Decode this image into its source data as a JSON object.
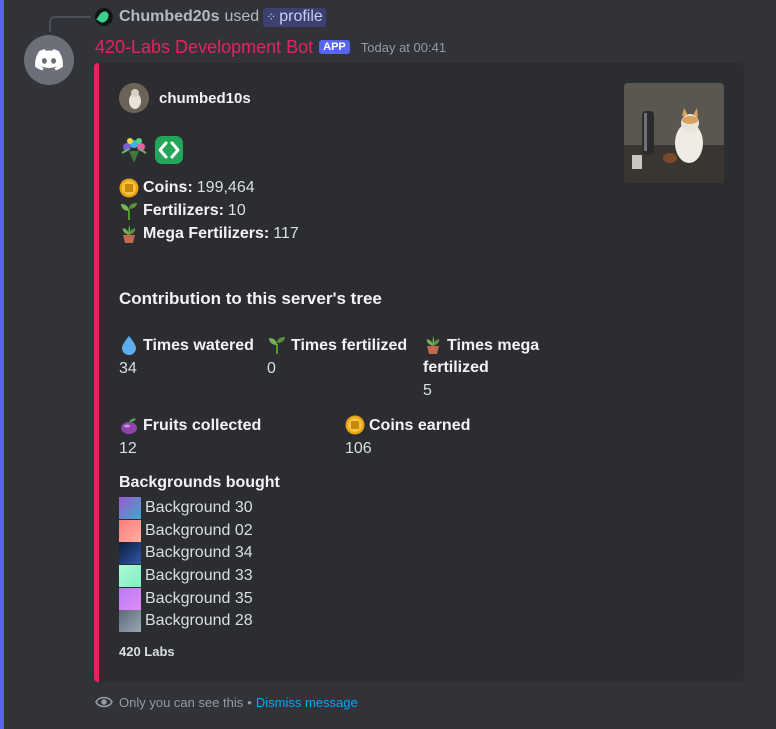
{
  "reply": {
    "user": "Chumbed20s",
    "used_text": "used",
    "command": "profile"
  },
  "message": {
    "bot_name": "420-Labs Development Bot",
    "badge": "APP",
    "timestamp": "Today at 00:41"
  },
  "embed": {
    "accent_color": "#e4245c",
    "author": "chumbed10s",
    "stats": [
      {
        "label": "Coins:",
        "value": "199,464",
        "icon": "coin-icon"
      },
      {
        "label": "Fertilizers:",
        "value": "10",
        "icon": "sprout-icon"
      },
      {
        "label": "Mega Fertilizers:",
        "value": "117",
        "icon": "potted-plant-icon"
      }
    ],
    "section_title": "Contribution to this server's tree",
    "fields": {
      "watered": {
        "label": "Times watered",
        "value": "34",
        "icon": "water-drop-icon"
      },
      "fertilized": {
        "label": "Times fertilized",
        "value": "0",
        "icon": "sprout-icon"
      },
      "mega": {
        "label": "Times mega fertilized",
        "value": "5",
        "icon": "potted-plant-icon"
      },
      "fruits": {
        "label": "Fruits collected",
        "value": "12",
        "icon": "fruit-icon"
      },
      "coins_earned": {
        "label": "Coins earned",
        "value": "106",
        "icon": "coin-icon"
      }
    },
    "backgrounds_title": "Backgrounds bought",
    "backgrounds": [
      {
        "name": "Background 30",
        "colors": [
          "#9b59d0",
          "#3fa9c9"
        ]
      },
      {
        "name": "Background 02",
        "colors": [
          "#ff7b7b",
          "#ffb0a0"
        ]
      },
      {
        "name": "Background 34",
        "colors": [
          "#0c1b3a",
          "#2e5aa8"
        ]
      },
      {
        "name": "Background 33",
        "colors": [
          "#aef8d8",
          "#7ef0c0"
        ]
      },
      {
        "name": "Background 35",
        "colors": [
          "#b57cf0",
          "#e08cf8"
        ]
      },
      {
        "name": "Background 28",
        "colors": [
          "#5c6a78",
          "#9aa8b4"
        ]
      }
    ],
    "footer": "420 Labs"
  },
  "ephemeral": {
    "note": "Only you can see this",
    "separator": "•",
    "dismiss": "Dismiss message"
  }
}
